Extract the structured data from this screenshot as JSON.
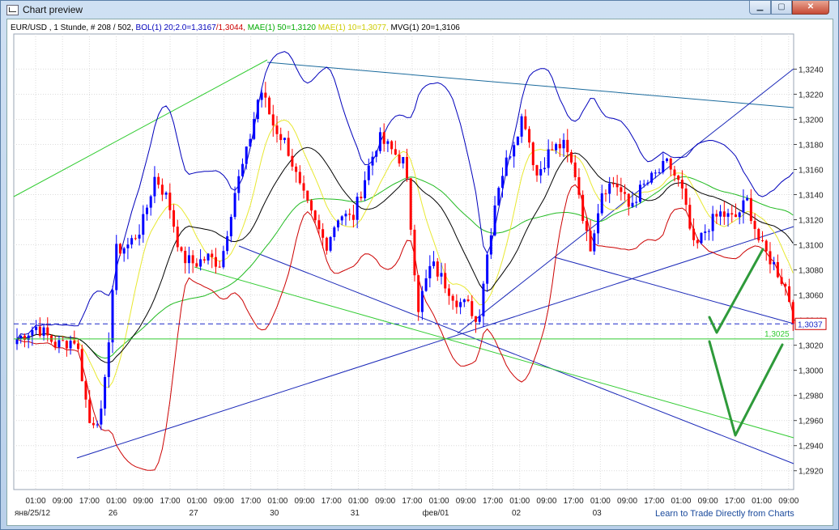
{
  "window": {
    "title": "Chart preview",
    "buttons": {
      "minimize": "▁",
      "maximize": "▢",
      "close": "✕"
    }
  },
  "header": {
    "segments": [
      {
        "text": "EUR/USD , 1 Stunde, # 208 / 502, ",
        "color": "#000000"
      },
      {
        "text": "BOL(1) 20;2.0=1,3167",
        "color": "#0000bb"
      },
      {
        "text": "/1,3044, ",
        "color": "#cc0000"
      },
      {
        "text": "MAE(1) 50=1,3120",
        "color": "#00aa00"
      },
      {
        "text": " MAE(1) 10=1,3077, ",
        "color": "#cccc00"
      },
      {
        "text": "MVG(1) 20=1,3106",
        "color": "#000000"
      }
    ]
  },
  "footer": {
    "link": "Learn to Trade Directly from Charts"
  },
  "chart_data": {
    "type": "candlestick",
    "symbol": "EUR/USD",
    "ylim": [
      1.2905,
      1.3268
    ],
    "y_ticks": [
      "1,3240",
      "1,3220",
      "1,3200",
      "1,3180",
      "1,3160",
      "1,3140",
      "1,3120",
      "1,3100",
      "1,3080",
      "1,3060",
      "1,3040",
      "1,3020",
      "1,3000",
      "1,2980",
      "1,2960",
      "1,2940",
      "1,2920"
    ],
    "y_tick_values": [
      1.324,
      1.322,
      1.32,
      1.318,
      1.316,
      1.314,
      1.312,
      1.31,
      1.308,
      1.306,
      1.304,
      1.302,
      1.3,
      1.298,
      1.296,
      1.294,
      1.292
    ],
    "x_ticks": [
      "01:00",
      "09:00",
      "17:00",
      "01:00",
      "09:00",
      "17:00",
      "01:00",
      "09:00",
      "17:00",
      "01:00",
      "09:00",
      "17:00",
      "01:00",
      "09:00",
      "17:00",
      "01:00",
      "09:00",
      "17:00",
      "01:00",
      "09:00",
      "17:00",
      "01:00",
      "09:00",
      "17:00",
      "01:00",
      "09:00",
      "17:00",
      "01:00",
      "09:00"
    ],
    "date_labels": [
      {
        "text": "янв/25/12",
        "bar": 0
      },
      {
        "text": "26",
        "bar": 23
      },
      {
        "text": "27",
        "bar": 47
      },
      {
        "text": "30",
        "bar": 71
      },
      {
        "text": "31",
        "bar": 95
      },
      {
        "text": "фев/01",
        "bar": 119
      },
      {
        "text": "02",
        "bar": 143
      },
      {
        "text": "03",
        "bar": 167
      }
    ],
    "bar_count": 204,
    "candles": {
      "anchors": [
        [
          0,
          1.3025
        ],
        [
          6,
          1.3035
        ],
        [
          12,
          1.302
        ],
        [
          18,
          1.3025
        ],
        [
          22,
          1.2958
        ],
        [
          26,
          1.2965
        ],
        [
          30,
          1.3095
        ],
        [
          34,
          1.31
        ],
        [
          38,
          1.3115
        ],
        [
          42,
          1.3155
        ],
        [
          46,
          1.3135
        ],
        [
          50,
          1.309
        ],
        [
          54,
          1.3085
        ],
        [
          58,
          1.309
        ],
        [
          62,
          1.3085
        ],
        [
          66,
          1.314
        ],
        [
          70,
          1.3175
        ],
        [
          74,
          1.3225
        ],
        [
          78,
          1.3195
        ],
        [
          82,
          1.318
        ],
        [
          86,
          1.3145
        ],
        [
          90,
          1.312
        ],
        [
          94,
          1.31
        ],
        [
          98,
          1.3125
        ],
        [
          102,
          1.312
        ],
        [
          106,
          1.3155
        ],
        [
          110,
          1.3185
        ],
        [
          114,
          1.3175
        ],
        [
          118,
          1.3165
        ],
        [
          122,
          1.305
        ],
        [
          126,
          1.3085
        ],
        [
          130,
          1.307
        ],
        [
          134,
          1.3055
        ],
        [
          138,
          1.305
        ],
        [
          140,
          1.3035
        ],
        [
          142,
          1.3075
        ],
        [
          146,
          1.3145
        ],
        [
          150,
          1.3175
        ],
        [
          154,
          1.3205
        ],
        [
          158,
          1.3155
        ],
        [
          162,
          1.3175
        ],
        [
          166,
          1.318
        ],
        [
          170,
          1.3155
        ],
        [
          174,
          1.3095
        ],
        [
          178,
          1.3145
        ],
        [
          182,
          1.315
        ],
        [
          186,
          1.313
        ],
        [
          190,
          1.3145
        ],
        [
          194,
          1.3155
        ],
        [
          198,
          1.3165
        ],
        [
          202,
          1.3145
        ],
        [
          206,
          1.3095
        ],
        [
          210,
          1.3115
        ],
        [
          214,
          1.3125
        ],
        [
          218,
          1.312
        ],
        [
          222,
          1.3135
        ],
        [
          226,
          1.31
        ],
        [
          230,
          1.3085
        ],
        [
          234,
          1.3065
        ],
        [
          236,
          1.3045
        ]
      ]
    },
    "last_price_label": "1,3037",
    "last_price": 1.3037,
    "hline_label": "1,3025",
    "hline_value": 1.3025,
    "colors": {
      "up": "#0000ff",
      "down": "#ff0000",
      "bol_upper": "#0000bb",
      "bol_lower": "#cc0000",
      "mae50": "#22bb22",
      "mae10": "#e8e830",
      "mvg": "#000000",
      "trend_blue": "#1a28b8",
      "trend_green": "#33cc33",
      "arrow": "#2e9a3a"
    }
  }
}
